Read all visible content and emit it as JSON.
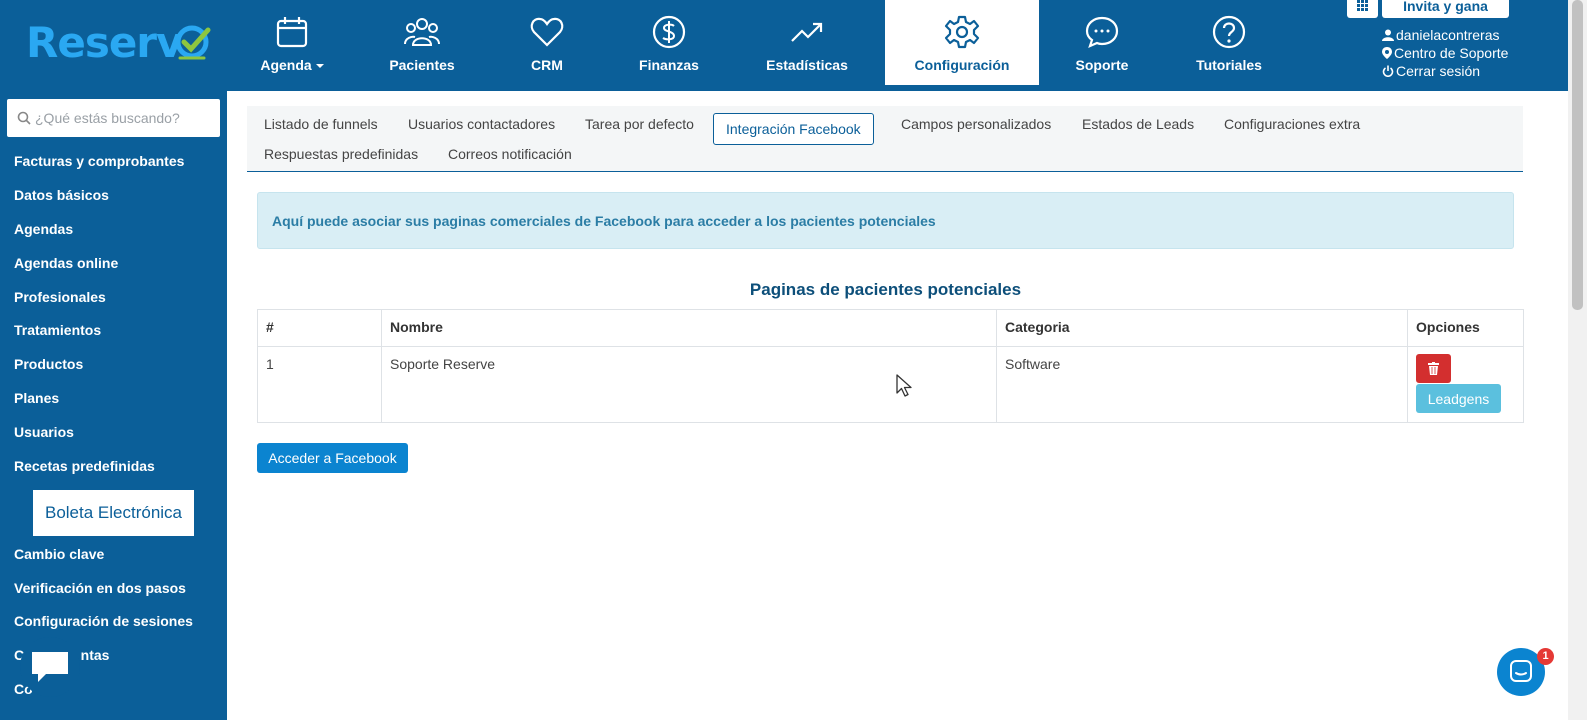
{
  "brand": {
    "logo_text": "Reserv",
    "accent": "#0b5f99",
    "logo_color": "#2aa8f2",
    "check_color": "#8dc63f"
  },
  "nav": [
    {
      "label": "Agenda",
      "icon": "calendar-icon"
    },
    {
      "label": "Pacientes",
      "icon": "users-icon"
    },
    {
      "label": "CRM",
      "icon": "heart-icon"
    },
    {
      "label": "Finanzas",
      "icon": "dollar-icon"
    },
    {
      "label": "Estadísticas",
      "icon": "trend-icon"
    },
    {
      "label": "Configuración",
      "icon": "gear-icon",
      "active": true
    },
    {
      "label": "Soporte",
      "icon": "chat-icon"
    },
    {
      "label": "Tutoriales",
      "icon": "help-icon"
    }
  ],
  "header_right": {
    "invite_label": "Invita y gana",
    "username": "danielacontreras",
    "support_center": "Centro de Soporte",
    "logout": "Cerrar sesión"
  },
  "sidebar": {
    "search_placeholder": "¿Qué estás buscando?",
    "items": [
      "Facturas y comprobantes",
      "Datos básicos",
      "Agendas",
      "Agendas online",
      "Profesionales",
      "Tratamientos",
      "Productos",
      "Planes",
      "Usuarios",
      "Recetas predefinidas"
    ],
    "boleta": "Boleta Electrónica",
    "items_after": [
      "Cambio clave",
      "Verificación en dos pasos",
      "Configuración de sesiones",
      "Co",
      "ntas",
      "Co"
    ]
  },
  "tabs": {
    "row1": [
      "Listado de funnels",
      "Usuarios contactadores",
      "Tarea por defecto",
      "Integración Facebook",
      "Campos personalizados",
      "Estados de Leads",
      "Configuraciones extra"
    ],
    "row2": [
      "Respuestas predefinidas",
      "Correos notificación"
    ],
    "active": "Integración Facebook"
  },
  "alert_text": "Aquí puede asociar sus paginas comerciales de Facebook para acceder a los pacientes potenciales",
  "table": {
    "title": "Paginas de pacientes potenciales",
    "headers": [
      "#",
      "Nombre",
      "Categoria",
      "Opciones"
    ],
    "rows": [
      {
        "num": "1",
        "nombre": "Soporte Reserve",
        "categoria": "Software"
      }
    ],
    "leadgens_label": "Leadgens"
  },
  "facebook_button": "Acceder a Facebook",
  "intercom_badge": "1"
}
